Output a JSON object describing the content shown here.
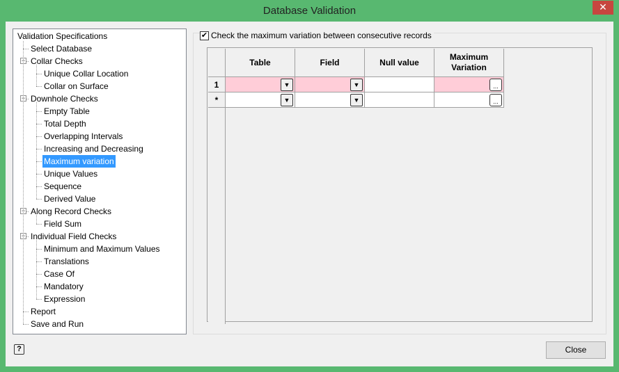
{
  "window": {
    "title": "Database Validation",
    "close_glyph": "✕"
  },
  "tree": {
    "root": "Validation Specifications",
    "items": [
      {
        "label": "Select Database",
        "level": 1
      },
      {
        "label": "Collar Checks",
        "level": 1,
        "expanded": true
      },
      {
        "label": "Unique Collar Location",
        "level": 2
      },
      {
        "label": "Collar on Surface",
        "level": 2
      },
      {
        "label": "Downhole Checks",
        "level": 1,
        "expanded": true
      },
      {
        "label": "Empty Table",
        "level": 2
      },
      {
        "label": "Total Depth",
        "level": 2
      },
      {
        "label": "Overlapping Intervals",
        "level": 2
      },
      {
        "label": "Increasing and Decreasing",
        "level": 2
      },
      {
        "label": "Maximum variation",
        "level": 2,
        "selected": true
      },
      {
        "label": "Unique Values",
        "level": 2
      },
      {
        "label": "Sequence",
        "level": 2
      },
      {
        "label": "Derived Value",
        "level": 2
      },
      {
        "label": "Along Record Checks",
        "level": 1,
        "expanded": true
      },
      {
        "label": "Field Sum",
        "level": 2
      },
      {
        "label": "Individual Field Checks",
        "level": 1,
        "expanded": true
      },
      {
        "label": "Minimum and Maximum Values",
        "level": 2
      },
      {
        "label": "Translations",
        "level": 2
      },
      {
        "label": "Case Of",
        "level": 2
      },
      {
        "label": "Mandatory",
        "level": 2
      },
      {
        "label": "Expression",
        "level": 2
      },
      {
        "label": "Report",
        "level": 1
      },
      {
        "label": "Save and Run",
        "level": 1
      }
    ]
  },
  "option": {
    "label": "Check the maximum variation between consecutive records",
    "checked": true,
    "check_glyph": "✔"
  },
  "grid": {
    "columns": [
      "Table",
      "Field",
      "Null value",
      "Maximum\nVariation"
    ],
    "rows": [
      {
        "header": "1",
        "table": "",
        "field": "",
        "null_value": "",
        "max_variation": "",
        "required": true
      },
      {
        "header": "*",
        "table": "",
        "field": "",
        "null_value": "",
        "max_variation": "",
        "required": false
      }
    ],
    "dropdown_glyph": "▼",
    "ellipsis_glyph": "..."
  },
  "footer": {
    "close_label": "Close",
    "help_glyph": "?"
  },
  "colors": {
    "title_bar": "#58b870",
    "required_cell": "#ffcdd8",
    "selection": "#3399ff"
  }
}
